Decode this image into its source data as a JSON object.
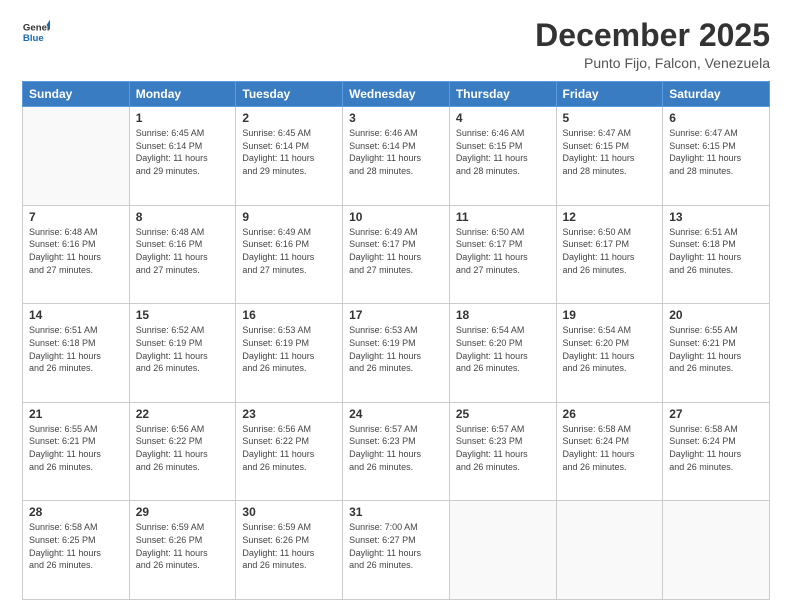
{
  "header": {
    "logo_general": "General",
    "logo_blue": "Blue",
    "month_title": "December 2025",
    "location": "Punto Fijo, Falcon, Venezuela"
  },
  "days_of_week": [
    "Sunday",
    "Monday",
    "Tuesday",
    "Wednesday",
    "Thursday",
    "Friday",
    "Saturday"
  ],
  "weeks": [
    [
      {
        "day": "",
        "empty": true
      },
      {
        "day": "1",
        "rise": "6:45 AM",
        "set": "6:14 PM",
        "daylight": "11 hours and 29 minutes."
      },
      {
        "day": "2",
        "rise": "6:45 AM",
        "set": "6:14 PM",
        "daylight": "11 hours and 29 minutes."
      },
      {
        "day": "3",
        "rise": "6:46 AM",
        "set": "6:14 PM",
        "daylight": "11 hours and 28 minutes."
      },
      {
        "day": "4",
        "rise": "6:46 AM",
        "set": "6:15 PM",
        "daylight": "11 hours and 28 minutes."
      },
      {
        "day": "5",
        "rise": "6:47 AM",
        "set": "6:15 PM",
        "daylight": "11 hours and 28 minutes."
      },
      {
        "day": "6",
        "rise": "6:47 AM",
        "set": "6:15 PM",
        "daylight": "11 hours and 28 minutes."
      }
    ],
    [
      {
        "day": "7",
        "rise": "6:48 AM",
        "set": "6:16 PM",
        "daylight": "11 hours and 27 minutes."
      },
      {
        "day": "8",
        "rise": "6:48 AM",
        "set": "6:16 PM",
        "daylight": "11 hours and 27 minutes."
      },
      {
        "day": "9",
        "rise": "6:49 AM",
        "set": "6:16 PM",
        "daylight": "11 hours and 27 minutes."
      },
      {
        "day": "10",
        "rise": "6:49 AM",
        "set": "6:17 PM",
        "daylight": "11 hours and 27 minutes."
      },
      {
        "day": "11",
        "rise": "6:50 AM",
        "set": "6:17 PM",
        "daylight": "11 hours and 27 minutes."
      },
      {
        "day": "12",
        "rise": "6:50 AM",
        "set": "6:17 PM",
        "daylight": "11 hours and 26 minutes."
      },
      {
        "day": "13",
        "rise": "6:51 AM",
        "set": "6:18 PM",
        "daylight": "11 hours and 26 minutes."
      }
    ],
    [
      {
        "day": "14",
        "rise": "6:51 AM",
        "set": "6:18 PM",
        "daylight": "11 hours and 26 minutes."
      },
      {
        "day": "15",
        "rise": "6:52 AM",
        "set": "6:19 PM",
        "daylight": "11 hours and 26 minutes."
      },
      {
        "day": "16",
        "rise": "6:53 AM",
        "set": "6:19 PM",
        "daylight": "11 hours and 26 minutes."
      },
      {
        "day": "17",
        "rise": "6:53 AM",
        "set": "6:19 PM",
        "daylight": "11 hours and 26 minutes."
      },
      {
        "day": "18",
        "rise": "6:54 AM",
        "set": "6:20 PM",
        "daylight": "11 hours and 26 minutes."
      },
      {
        "day": "19",
        "rise": "6:54 AM",
        "set": "6:20 PM",
        "daylight": "11 hours and 26 minutes."
      },
      {
        "day": "20",
        "rise": "6:55 AM",
        "set": "6:21 PM",
        "daylight": "11 hours and 26 minutes."
      }
    ],
    [
      {
        "day": "21",
        "rise": "6:55 AM",
        "set": "6:21 PM",
        "daylight": "11 hours and 26 minutes."
      },
      {
        "day": "22",
        "rise": "6:56 AM",
        "set": "6:22 PM",
        "daylight": "11 hours and 26 minutes."
      },
      {
        "day": "23",
        "rise": "6:56 AM",
        "set": "6:22 PM",
        "daylight": "11 hours and 26 minutes."
      },
      {
        "day": "24",
        "rise": "6:57 AM",
        "set": "6:23 PM",
        "daylight": "11 hours and 26 minutes."
      },
      {
        "day": "25",
        "rise": "6:57 AM",
        "set": "6:23 PM",
        "daylight": "11 hours and 26 minutes."
      },
      {
        "day": "26",
        "rise": "6:58 AM",
        "set": "6:24 PM",
        "daylight": "11 hours and 26 minutes."
      },
      {
        "day": "27",
        "rise": "6:58 AM",
        "set": "6:24 PM",
        "daylight": "11 hours and 26 minutes."
      }
    ],
    [
      {
        "day": "28",
        "rise": "6:58 AM",
        "set": "6:25 PM",
        "daylight": "11 hours and 26 minutes."
      },
      {
        "day": "29",
        "rise": "6:59 AM",
        "set": "6:26 PM",
        "daylight": "11 hours and 26 minutes."
      },
      {
        "day": "30",
        "rise": "6:59 AM",
        "set": "6:26 PM",
        "daylight": "11 hours and 26 minutes."
      },
      {
        "day": "31",
        "rise": "7:00 AM",
        "set": "6:27 PM",
        "daylight": "11 hours and 26 minutes."
      },
      {
        "day": "",
        "empty": true
      },
      {
        "day": "",
        "empty": true
      },
      {
        "day": "",
        "empty": true
      }
    ]
  ],
  "cell_labels": {
    "sunrise": "Sunrise: ",
    "sunset": "Sunset: ",
    "daylight": "Daylight: "
  }
}
